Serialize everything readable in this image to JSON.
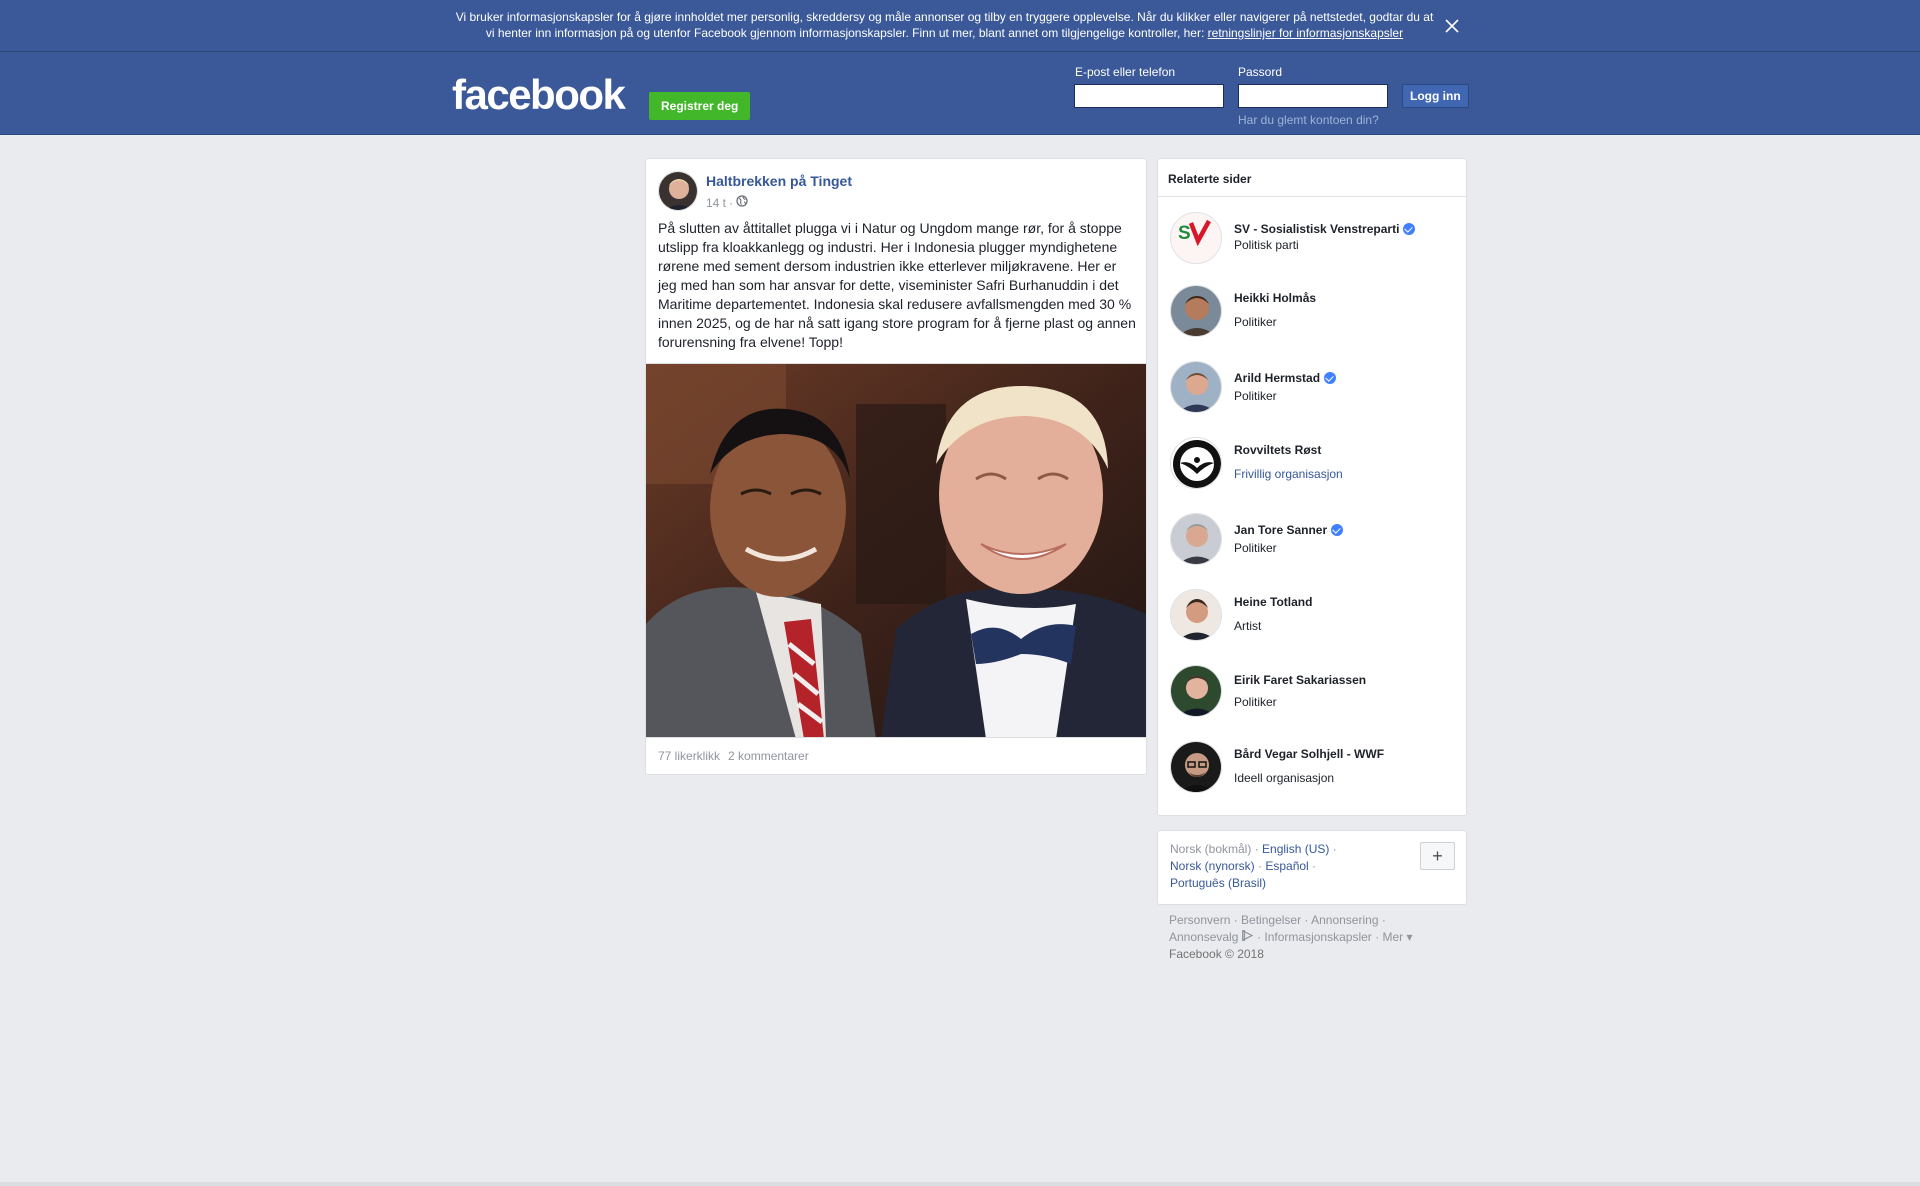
{
  "cookie_banner": {
    "text": "Vi bruker informasjonskapsler for å gjøre innholdet mer personlig, skreddersy og måle annonser og tilby en tryggere opplevelse. Når du klikker eller navigerer på nettstedet, godtar du at vi henter inn informasjon på og utenfor Facebook gjennom informasjonskapsler. Finn ut mer, blant annet om tilgjengelige kontroller, her: ",
    "link": "retningslinjer for informasjonskapsler",
    "close_icon": "close-icon"
  },
  "header": {
    "logo": "facebook",
    "register_label": "Registrer deg",
    "email_label": "E-post eller telefon",
    "email_value": "",
    "password_label": "Passord",
    "password_value": "",
    "login_label": "Logg inn",
    "forgot_label": "Har du glemt kontoen din?"
  },
  "post": {
    "author": "Haltbrekken på Tinget",
    "time": "14 t",
    "separator": "·",
    "audience_icon": "globe-icon",
    "text": "På slutten av åttitallet plugga vi i Natur og Ungdom mange rør, for å stoppe utslipp fra kloakkanlegg og industri. Her i Indonesia plugger myndighetene rørene med sement dersom industrien ikke etterlever miljøkravene. Her er jeg med han som har ansvar for dette, viseminister Safri Burhanuddin i det Maritime departementet. Indonesia skal redusere avfallsmengden med 30 % innen 2025, og de har nå satt igang store program for å fjerne plast og annen forurensning fra elvene! Topp!",
    "likes": "77 likerklikk",
    "comments": "2 kommentarer"
  },
  "related": {
    "title": "Relaterte sider",
    "items": [
      {
        "name": "SV - Sosialistisk Venstreparti",
        "verified": true,
        "category": "Politisk parti",
        "link": false
      },
      {
        "name": "Heikki Holmås",
        "verified": false,
        "category": "Politiker",
        "link": false
      },
      {
        "name": "Arild Hermstad",
        "verified": true,
        "category": "Politiker",
        "link": false
      },
      {
        "name": "Rovviltets Røst",
        "verified": false,
        "category": "Frivillig organisasjon",
        "link": true
      },
      {
        "name": "Jan Tore Sanner",
        "verified": true,
        "category": "Politiker",
        "link": false
      },
      {
        "name": "Heine Totland",
        "verified": false,
        "category": "Artist",
        "link": false
      },
      {
        "name": "Eirik Faret Sakariassen",
        "verified": false,
        "category": "Politiker",
        "link": false
      },
      {
        "name": "Bård Vegar Solhjell - WWF",
        "verified": false,
        "category": "Ideell organisasjon",
        "link": false
      }
    ]
  },
  "languages": {
    "current": "Norsk (bokmål)",
    "options": [
      "English (US)",
      "Norsk (nynorsk)",
      "Español",
      "Português (Brasil)"
    ],
    "plus_label": "+"
  },
  "footer": {
    "links": [
      "Personvern",
      "Betingelser",
      "Annonsering",
      "Annonsevalg",
      "Informasjonskapsler",
      "Mer"
    ],
    "copyright": "Facebook © 2018"
  },
  "colors": {
    "brand_blue": "#3b5998",
    "register_green": "#42b72a",
    "link_blue": "#365899",
    "verified_blue": "#4080ff"
  }
}
